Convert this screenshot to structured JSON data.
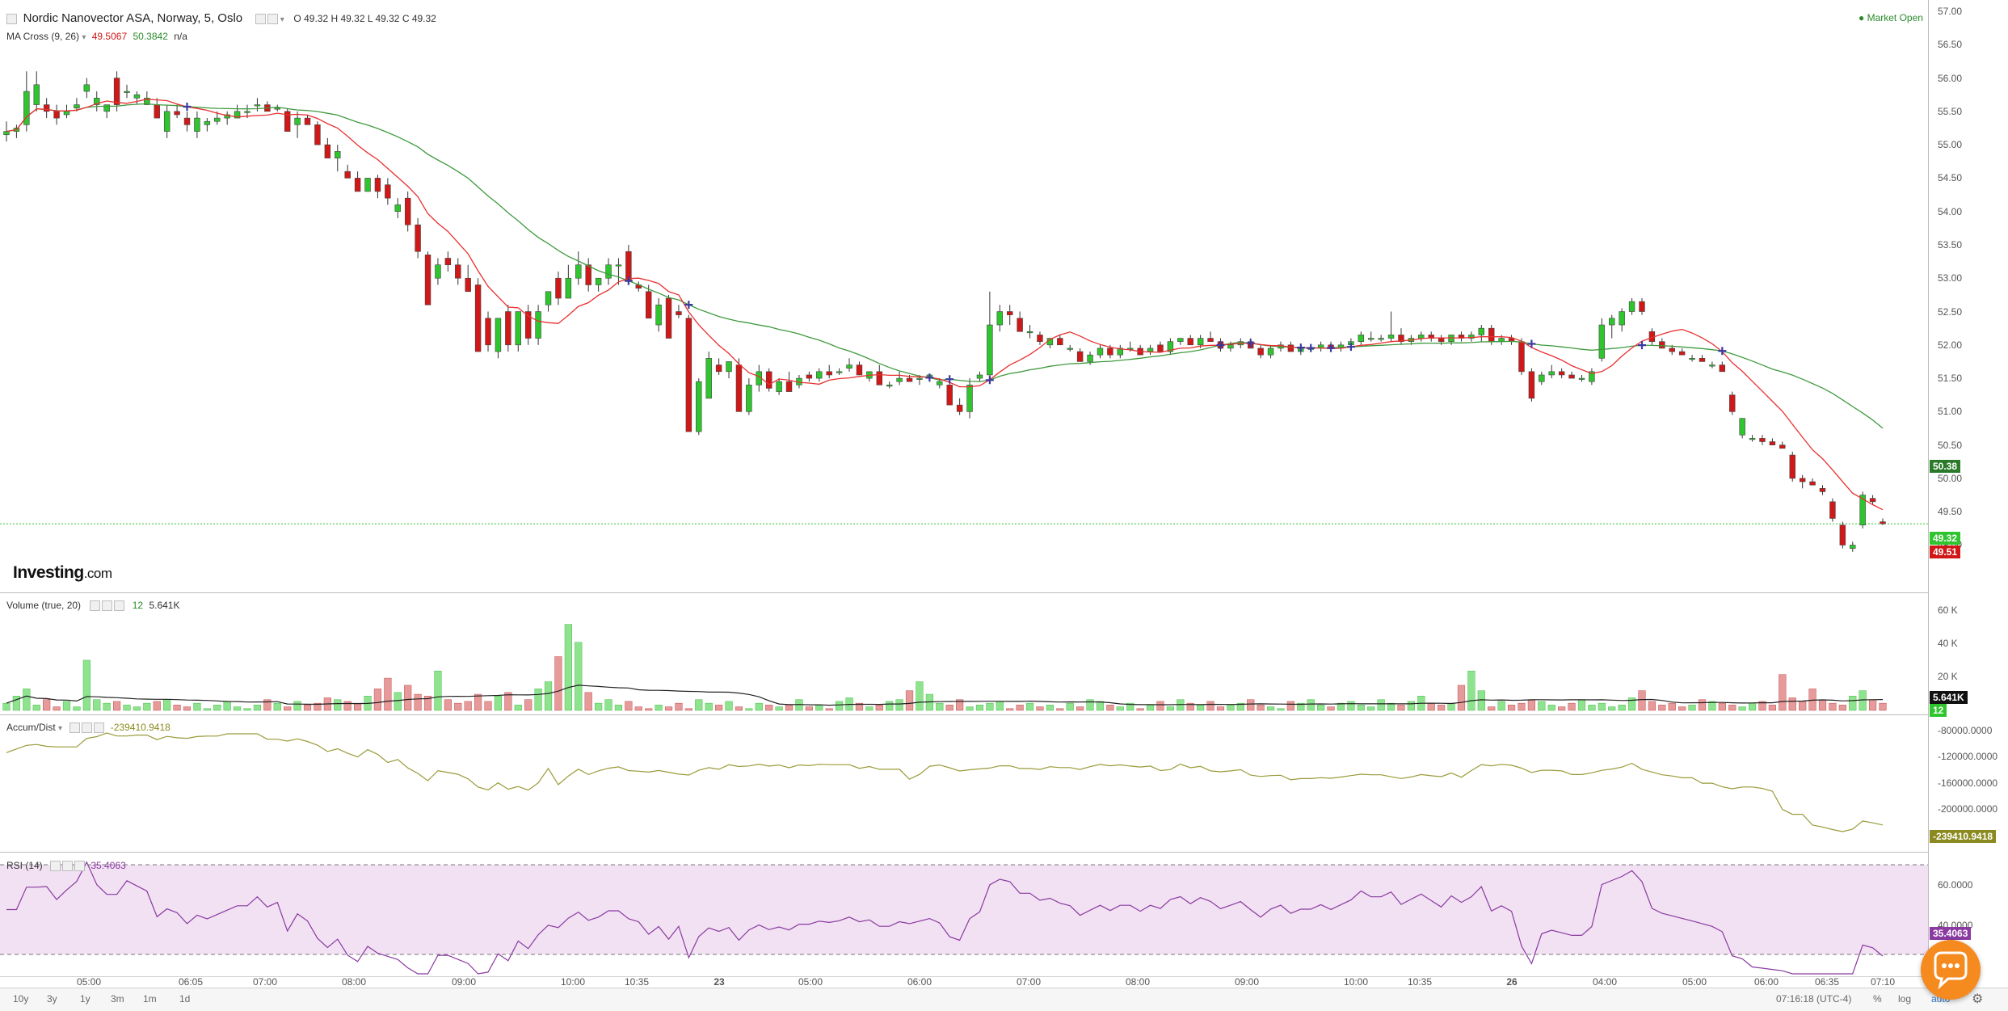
{
  "header": {
    "symbol_title": "Nordic Nanovector ASA, Norway, 5, Oslo",
    "ohlc": {
      "o_label": "O",
      "o": "49.32",
      "h_label": "H",
      "h": "49.32",
      "l_label": "L",
      "l": "49.32",
      "c_label": "C",
      "c": "49.32"
    },
    "market_status": "Market Open"
  },
  "ma_indicator": {
    "label": "MA Cross (9, 26)",
    "fast_value": "49.5067",
    "slow_value": "50.3842",
    "extra": "n/a"
  },
  "logo": {
    "brand": "Investing",
    "suffix": ".com"
  },
  "price_axis": {
    "ticks": [
      "57.00",
      "56.50",
      "56.00",
      "55.50",
      "55.00",
      "54.50",
      "54.00",
      "53.50",
      "53.00",
      "52.50",
      "52.00",
      "51.50",
      "51.00",
      "50.50",
      "50.00",
      "49.50",
      "49.00"
    ],
    "tags": {
      "ma_slow": "50.38",
      "last": "49.32",
      "ma_fast": "49.51"
    }
  },
  "volume": {
    "label": "Volume (true, 20)",
    "value_a": "12",
    "value_b": "5.641K",
    "axis": [
      "60 K",
      "40 K",
      "20 K"
    ],
    "tags": {
      "avg": "5.641K",
      "last": "12"
    }
  },
  "accum": {
    "label": "Accum/Dist",
    "value": "-239410.9418",
    "axis": [
      "-80000.0000",
      "-120000.0000",
      "-160000.0000",
      "-200000.0000"
    ],
    "tag": "-239410.9418"
  },
  "rsi": {
    "label": "RSI (14)",
    "value": "35.4063",
    "axis": [
      "60.0000",
      "40.0000"
    ],
    "tag": "35.4063"
  },
  "time_axis": [
    "05:00",
    "06:05",
    "07:00",
    "08:00",
    "09:00",
    "10:00",
    "10:35",
    "23",
    "05:00",
    "06:00",
    "07:00",
    "08:00",
    "09:00",
    "10:00",
    "10:35",
    "26",
    "04:00",
    "05:00",
    "06:00",
    "06:35",
    "07:10"
  ],
  "timeframes": [
    "10y",
    "3y",
    "1y",
    "3m",
    "1m",
    "1d"
  ],
  "footer": {
    "clock": "07:16:18 (UTC-4)",
    "percent": "%",
    "log": "log",
    "auto": "auto"
  },
  "colors": {
    "up": "#2ec52e",
    "down": "#d01818",
    "ma_fast": "#e83030",
    "ma_slow": "#3f9a3f",
    "accum": "#9a9a3a",
    "rsi": "#8a3aa0",
    "rsi_band": "#f1e1f3",
    "cross": "#3a3aa0"
  },
  "chart_data": {
    "type": "candlestick",
    "title": "Nordic Nanovector ASA, Norway, 5, Oslo",
    "x": [
      "05:00",
      "06:05",
      "07:00",
      "08:00",
      "09:00",
      "10:00",
      "10:35",
      "23",
      "05:00",
      "06:00",
      "07:00",
      "08:00",
      "09:00",
      "10:00",
      "10:35",
      "26",
      "04:00",
      "05:00",
      "06:00",
      "06:35",
      "07:10"
    ],
    "ylim": [
      48.8,
      57.0
    ],
    "candles": [
      [
        55.15,
        55.35,
        55.05,
        55.2
      ],
      [
        55.2,
        55.3,
        55.1,
        55.25
      ],
      [
        55.3,
        56.1,
        55.2,
        55.8
      ],
      [
        55.6,
        56.1,
        55.5,
        55.9
      ],
      [
        55.6,
        55.7,
        55.4,
        55.5
      ],
      [
        55.5,
        55.6,
        55.3,
        55.4
      ],
      [
        55.45,
        55.6,
        55.4,
        55.5
      ],
      [
        55.55,
        55.7,
        55.5,
        55.6
      ],
      [
        55.8,
        56.0,
        55.7,
        55.9
      ],
      [
        55.6,
        55.8,
        55.5,
        55.7
      ],
      [
        55.5,
        55.6,
        55.4,
        55.6
      ],
      [
        56.0,
        56.1,
        55.5,
        55.6
      ],
      [
        55.8,
        55.9,
        55.7,
        55.8
      ],
      [
        55.7,
        55.8,
        55.6,
        55.75
      ],
      [
        55.6,
        55.8,
        55.6,
        55.7
      ],
      [
        55.6,
        55.7,
        55.4,
        55.4
      ],
      [
        55.2,
        55.6,
        55.1,
        55.5
      ],
      [
        55.5,
        55.6,
        55.4,
        55.45
      ],
      [
        55.4,
        55.5,
        55.2,
        55.3
      ],
      [
        55.2,
        55.5,
        55.1,
        55.4
      ],
      [
        55.3,
        55.4,
        55.2,
        55.35
      ],
      [
        55.35,
        55.5,
        55.3,
        55.4
      ],
      [
        55.4,
        55.5,
        55.3,
        55.45
      ],
      [
        55.4,
        55.6,
        55.4,
        55.5
      ],
      [
        55.5,
        55.6,
        55.4,
        55.5
      ],
      [
        55.6,
        55.7,
        55.5,
        55.6
      ],
      [
        55.6,
        55.65,
        55.5,
        55.5
      ],
      [
        55.55,
        55.6,
        55.5,
        55.55
      ],
      [
        55.5,
        55.55,
        55.2,
        55.2
      ],
      [
        55.3,
        55.5,
        55.1,
        55.4
      ],
      [
        55.4,
        55.45,
        55.3,
        55.3
      ],
      [
        55.3,
        55.35,
        55.0,
        55.0
      ],
      [
        55.0,
        55.1,
        54.8,
        54.8
      ],
      [
        54.8,
        55.0,
        54.6,
        54.9
      ],
      [
        54.6,
        54.7,
        54.5,
        54.5
      ],
      [
        54.5,
        54.6,
        54.3,
        54.3
      ],
      [
        54.3,
        54.5,
        54.3,
        54.5
      ],
      [
        54.5,
        54.55,
        54.2,
        54.3
      ],
      [
        54.4,
        54.5,
        54.1,
        54.2
      ],
      [
        54.0,
        54.2,
        53.9,
        54.1
      ],
      [
        54.2,
        54.3,
        53.7,
        53.8
      ],
      [
        53.8,
        53.9,
        53.3,
        53.4
      ],
      [
        53.35,
        53.4,
        52.6,
        52.6
      ],
      [
        53.0,
        53.3,
        52.9,
        53.2
      ],
      [
        53.3,
        53.4,
        53.1,
        53.2
      ],
      [
        53.2,
        53.3,
        52.9,
        53.0
      ],
      [
        53.0,
        53.2,
        52.8,
        52.8
      ],
      [
        52.9,
        53.0,
        51.9,
        51.9
      ],
      [
        52.4,
        52.5,
        51.9,
        52.0
      ],
      [
        51.9,
        52.4,
        51.8,
        52.4
      ],
      [
        52.5,
        52.6,
        51.9,
        52.0
      ],
      [
        52.0,
        52.5,
        51.9,
        52.5
      ],
      [
        52.5,
        52.6,
        52.0,
        52.1
      ],
      [
        52.1,
        52.6,
        52.0,
        52.5
      ],
      [
        52.6,
        52.8,
        52.5,
        52.8
      ],
      [
        53.0,
        53.1,
        52.6,
        52.7
      ],
      [
        52.7,
        53.2,
        52.7,
        53.0
      ],
      [
        53.0,
        53.4,
        52.9,
        53.2
      ],
      [
        53.2,
        53.3,
        52.8,
        52.9
      ],
      [
        52.9,
        53.0,
        52.8,
        53.0
      ],
      [
        53.0,
        53.3,
        52.9,
        53.2
      ],
      [
        53.2,
        53.3,
        52.9,
        53.2
      ],
      [
        53.4,
        53.5,
        52.9,
        52.95
      ],
      [
        52.9,
        52.95,
        52.8,
        52.85
      ],
      [
        52.8,
        52.9,
        52.4,
        52.4
      ],
      [
        52.3,
        52.7,
        52.2,
        52.6
      ],
      [
        52.7,
        52.75,
        52.1,
        52.1
      ],
      [
        52.5,
        52.6,
        52.4,
        52.45
      ],
      [
        52.4,
        52.45,
        50.7,
        50.7
      ],
      [
        50.7,
        51.5,
        50.65,
        51.45
      ],
      [
        51.2,
        51.9,
        51.2,
        51.8
      ],
      [
        51.7,
        51.8,
        51.55,
        51.6
      ],
      [
        51.6,
        51.75,
        51.5,
        51.75
      ],
      [
        51.7,
        51.8,
        51.0,
        51.0
      ],
      [
        51.0,
        51.5,
        50.95,
        51.4
      ],
      [
        51.4,
        51.7,
        51.3,
        51.6
      ],
      [
        51.6,
        51.65,
        51.3,
        51.35
      ],
      [
        51.3,
        51.5,
        51.25,
        51.45
      ],
      [
        51.45,
        51.6,
        51.3,
        51.3
      ],
      [
        51.4,
        51.55,
        51.35,
        51.5
      ],
      [
        51.55,
        51.6,
        51.45,
        51.5
      ],
      [
        51.5,
        51.65,
        51.45,
        51.6
      ],
      [
        51.6,
        51.7,
        51.5,
        51.55
      ],
      [
        51.6,
        51.65,
        51.55,
        51.6
      ],
      [
        51.65,
        51.8,
        51.6,
        51.7
      ],
      [
        51.7,
        51.75,
        51.55,
        51.55
      ],
      [
        51.5,
        51.6,
        51.45,
        51.6
      ],
      [
        51.6,
        51.7,
        51.4,
        51.4
      ],
      [
        51.4,
        51.45,
        51.35,
        51.4
      ],
      [
        51.45,
        51.6,
        51.4,
        51.5
      ],
      [
        51.5,
        51.55,
        51.45,
        51.45
      ],
      [
        51.5,
        51.55,
        51.4,
        51.5
      ],
      [
        51.5,
        51.55,
        51.45,
        51.55
      ],
      [
        51.4,
        51.5,
        51.35,
        51.45
      ],
      [
        51.4,
        51.45,
        51.1,
        51.1
      ],
      [
        51.1,
        51.2,
        50.95,
        51.0
      ],
      [
        51.0,
        51.5,
        50.9,
        51.4
      ],
      [
        51.5,
        51.6,
        51.45,
        51.55
      ],
      [
        51.55,
        52.8,
        51.5,
        52.3
      ],
      [
        52.3,
        52.6,
        52.2,
        52.5
      ],
      [
        52.5,
        52.6,
        52.3,
        52.45
      ],
      [
        52.4,
        52.5,
        52.2,
        52.2
      ],
      [
        52.2,
        52.3,
        52.1,
        52.2
      ],
      [
        52.15,
        52.2,
        52.0,
        52.05
      ],
      [
        52.0,
        52.1,
        51.95,
        52.1
      ],
      [
        52.1,
        52.15,
        52.0,
        52.0
      ],
      [
        51.95,
        52.0,
        51.9,
        51.95
      ],
      [
        51.9,
        51.95,
        51.75,
        51.75
      ],
      [
        51.75,
        51.9,
        51.7,
        51.85
      ],
      [
        51.85,
        52.0,
        51.8,
        51.95
      ],
      [
        51.95,
        52.0,
        51.8,
        51.85
      ],
      [
        51.85,
        52.0,
        51.8,
        51.95
      ],
      [
        51.95,
        52.05,
        51.9,
        51.95
      ],
      [
        51.95,
        52.0,
        51.85,
        51.85
      ],
      [
        51.9,
        52.0,
        51.85,
        51.95
      ],
      [
        52.0,
        52.05,
        51.9,
        51.9
      ],
      [
        51.9,
        52.1,
        51.85,
        52.05
      ],
      [
        52.05,
        52.1,
        52.0,
        52.1
      ],
      [
        52.1,
        52.15,
        52.0,
        52.0
      ],
      [
        52.0,
        52.15,
        51.95,
        52.1
      ],
      [
        52.1,
        52.2,
        52.05,
        52.05
      ],
      [
        52.05,
        52.1,
        51.9,
        51.95
      ],
      [
        51.95,
        52.05,
        51.9,
        52.0
      ],
      [
        52.0,
        52.1,
        51.95,
        52.05
      ],
      [
        52.05,
        52.1,
        51.95,
        51.95
      ],
      [
        51.95,
        52.0,
        51.8,
        51.85
      ],
      [
        51.85,
        52.0,
        51.8,
        51.95
      ],
      [
        51.95,
        52.05,
        51.9,
        52.0
      ],
      [
        52.0,
        52.05,
        51.9,
        51.9
      ],
      [
        51.9,
        52.0,
        51.85,
        51.95
      ],
      [
        51.95,
        52.0,
        51.9,
        51.95
      ],
      [
        51.95,
        52.05,
        51.9,
        52.0
      ],
      [
        52.0,
        52.05,
        51.9,
        51.95
      ],
      [
        51.95,
        52.05,
        51.9,
        52.0
      ],
      [
        52.0,
        52.1,
        51.95,
        52.05
      ],
      [
        52.05,
        52.2,
        52.0,
        52.15
      ],
      [
        52.1,
        52.2,
        52.05,
        52.1
      ],
      [
        52.1,
        52.15,
        52.05,
        52.1
      ],
      [
        52.1,
        52.5,
        52.05,
        52.15
      ],
      [
        52.15,
        52.25,
        52.0,
        52.05
      ],
      [
        52.05,
        52.15,
        52.0,
        52.1
      ],
      [
        52.1,
        52.2,
        52.05,
        52.15
      ],
      [
        52.15,
        52.2,
        52.05,
        52.1
      ],
      [
        52.1,
        52.15,
        52.0,
        52.05
      ],
      [
        52.05,
        52.15,
        52.0,
        52.15
      ],
      [
        52.15,
        52.2,
        52.05,
        52.1
      ],
      [
        52.1,
        52.2,
        52.05,
        52.15
      ],
      [
        52.15,
        52.3,
        52.05,
        52.25
      ],
      [
        52.25,
        52.3,
        52.0,
        52.05
      ],
      [
        52.05,
        52.15,
        52.0,
        52.1
      ],
      [
        52.1,
        52.15,
        52.0,
        52.05
      ],
      [
        52.05,
        52.1,
        51.55,
        51.6
      ],
      [
        51.6,
        51.65,
        51.15,
        51.2
      ],
      [
        51.45,
        51.6,
        51.4,
        51.55
      ],
      [
        51.55,
        51.7,
        51.5,
        51.6
      ],
      [
        51.6,
        51.65,
        51.5,
        51.55
      ],
      [
        51.55,
        51.6,
        51.5,
        51.5
      ],
      [
        51.5,
        51.55,
        51.45,
        51.5
      ],
      [
        51.45,
        51.65,
        51.4,
        51.6
      ],
      [
        51.8,
        52.4,
        51.75,
        52.3
      ],
      [
        52.3,
        52.45,
        52.1,
        52.4
      ],
      [
        52.3,
        52.55,
        52.2,
        52.5
      ],
      [
        52.5,
        52.7,
        52.45,
        52.65
      ],
      [
        52.65,
        52.7,
        52.45,
        52.5
      ],
      [
        52.2,
        52.25,
        52.0,
        52.05
      ],
      [
        52.05,
        52.1,
        51.95,
        51.95
      ],
      [
        51.95,
        52.0,
        51.85,
        51.9
      ],
      [
        51.9,
        51.95,
        51.85,
        51.85
      ],
      [
        51.8,
        51.85,
        51.75,
        51.8
      ],
      [
        51.8,
        51.85,
        51.75,
        51.75
      ],
      [
        51.7,
        51.75,
        51.65,
        51.7
      ],
      [
        51.7,
        51.75,
        51.6,
        51.6
      ],
      [
        51.25,
        51.3,
        50.95,
        51.0
      ],
      [
        50.65,
        50.9,
        50.6,
        50.9
      ],
      [
        50.6,
        50.65,
        50.55,
        50.6
      ],
      [
        50.6,
        50.65,
        50.5,
        50.55
      ],
      [
        50.55,
        50.6,
        50.5,
        50.5
      ],
      [
        50.5,
        50.55,
        50.45,
        50.45
      ],
      [
        50.35,
        50.4,
        49.95,
        50.0
      ],
      [
        50.0,
        50.05,
        49.85,
        49.95
      ],
      [
        49.95,
        50.0,
        49.9,
        49.9
      ],
      [
        49.85,
        49.9,
        49.75,
        49.8
      ],
      [
        49.65,
        49.7,
        49.35,
        49.4
      ],
      [
        49.3,
        49.35,
        48.95,
        49.0
      ],
      [
        48.95,
        49.05,
        48.9,
        49.0
      ],
      [
        49.3,
        49.8,
        49.25,
        49.75
      ],
      [
        49.7,
        49.75,
        49.6,
        49.65
      ],
      [
        49.35,
        49.4,
        49.3,
        49.32
      ]
    ],
    "volume": [
      4,
      8,
      12,
      3,
      6,
      2,
      5,
      2,
      28,
      6,
      4,
      5,
      3,
      2,
      4,
      5,
      6,
      3,
      2,
      4,
      1,
      3,
      5,
      2,
      1,
      3,
      6,
      4,
      2,
      5,
      3,
      4,
      7,
      6,
      5,
      4,
      8,
      12,
      18,
      10,
      14,
      9,
      8,
      22,
      6,
      4,
      5,
      9,
      5,
      8,
      10,
      3,
      6,
      12,
      16,
      30,
      48,
      38,
      10,
      4,
      6,
      3,
      5,
      2,
      1,
      3,
      2,
      4,
      1,
      6,
      4,
      3,
      5,
      2,
      1,
      4,
      3,
      2,
      3,
      6,
      2,
      3,
      1,
      5,
      7,
      4,
      2,
      3,
      5,
      6,
      11,
      16,
      9,
      4,
      3,
      6,
      2,
      3,
      4,
      5,
      1,
      3,
      4,
      2,
      3,
      1,
      4,
      2,
      6,
      5,
      3,
      2,
      4,
      1,
      3,
      5,
      2,
      6,
      4,
      3,
      5,
      2,
      3,
      4,
      6,
      3,
      2,
      1,
      5,
      4,
      6,
      3,
      2,
      4,
      5,
      3,
      2,
      6,
      4,
      3,
      5,
      8,
      4,
      3,
      4,
      14,
      22,
      11,
      2,
      5,
      3,
      4,
      6,
      5,
      3,
      2,
      4,
      6,
      3,
      4,
      2,
      3,
      7,
      11,
      5,
      3,
      4,
      2,
      3,
      6,
      5,
      4,
      3,
      2,
      4,
      5,
      3,
      20,
      7,
      5,
      12,
      6,
      4,
      3,
      8,
      11,
      6,
      4,
      3,
      2
    ],
    "ma_fast_label": "MA Cross (9, 26)",
    "accum_label": "Accum/Dist",
    "rsi_label": "RSI (14)",
    "grid": false
  }
}
